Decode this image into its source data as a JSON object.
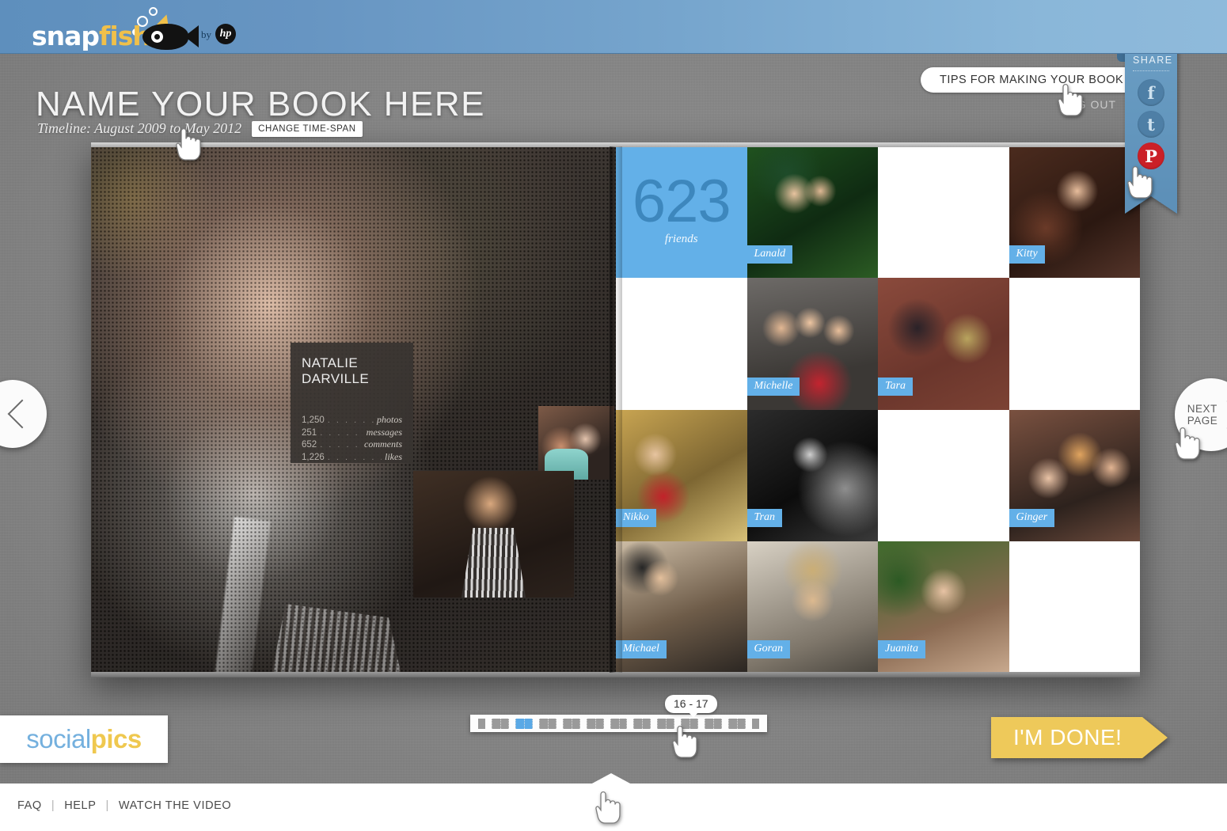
{
  "header": {
    "brand_snap": "snap",
    "brand_fish": "fish",
    "by_label": "by",
    "hp_label": "hp",
    "accent_blue": "#63b0e8",
    "header_blue": "#6795c2"
  },
  "topbar": {
    "tips_label": "TIPS FOR MAKING YOUR BOOK",
    "tips_help_glyph": "?",
    "logout_label": "LOG OUT"
  },
  "share": {
    "label": "SHARE",
    "items": [
      {
        "name": "facebook",
        "glyph": "f",
        "color": "#4e7fa6"
      },
      {
        "name": "twitter",
        "glyph": "t",
        "color": "#4e7fa6"
      },
      {
        "name": "pinterest",
        "glyph": "P",
        "color": "#cb2027"
      }
    ]
  },
  "title": {
    "book_name": "NAME YOUR BOOK HERE",
    "timeline": "Timeline: August 2009 to May 2012",
    "change_span_label": "CHANGE TIME-SPAN"
  },
  "left_page": {
    "person_name_line1": "NATALIE",
    "person_name_line2": "DARVILLE",
    "stats": [
      {
        "value": "1,250",
        "label": "photos"
      },
      {
        "value": "251",
        "label": "messages"
      },
      {
        "value": "652",
        "label": "comments"
      },
      {
        "value": "1,226",
        "label": "likes"
      }
    ],
    "dots": ". . . . . . . . . ."
  },
  "right_page": {
    "friends_count": "623",
    "friends_word": "friends",
    "grid": [
      {
        "type": "count"
      },
      {
        "type": "photo",
        "name": "Lanald",
        "style": "ph-lanald"
      },
      {
        "type": "empty"
      },
      {
        "type": "photo",
        "name": "Kitty",
        "style": "ph-kitty"
      },
      {
        "type": "empty"
      },
      {
        "type": "photo",
        "name": "Michelle",
        "style": "ph-michelle"
      },
      {
        "type": "photo",
        "name": "Tara",
        "style": "ph-tara"
      },
      {
        "type": "empty"
      },
      {
        "type": "photo",
        "name": "Nikko",
        "style": "ph-nikko"
      },
      {
        "type": "photo",
        "name": "Tran",
        "style": "ph-tran"
      },
      {
        "type": "empty"
      },
      {
        "type": "photo",
        "name": "Ginger",
        "style": "ph-ginger"
      },
      {
        "type": "photo",
        "name": "Michael",
        "style": "ph-michael"
      },
      {
        "type": "photo",
        "name": "Goran",
        "style": "ph-goran"
      },
      {
        "type": "photo",
        "name": "Juanita",
        "style": "ph-juanita"
      },
      {
        "type": "empty"
      }
    ]
  },
  "navigation": {
    "prev_icon": "chevron-left-icon",
    "next_label_line1": "NEXT",
    "next_label_line2": "PAGE"
  },
  "page_nav": {
    "current_spread_label": "16 - 17",
    "spreads": [
      {
        "kind": "single",
        "active": false
      },
      {
        "kind": "double",
        "active": false
      },
      {
        "kind": "double",
        "active": true
      },
      {
        "kind": "double",
        "active": false
      },
      {
        "kind": "double",
        "active": false
      },
      {
        "kind": "double",
        "active": false
      },
      {
        "kind": "double",
        "active": false
      },
      {
        "kind": "double",
        "active": false
      },
      {
        "kind": "double",
        "active": false
      },
      {
        "kind": "double",
        "active": false
      },
      {
        "kind": "double",
        "active": false
      },
      {
        "kind": "double",
        "active": false
      },
      {
        "kind": "single",
        "active": false
      }
    ]
  },
  "done": {
    "label": "I'M DONE!",
    "color": "#eec95a"
  },
  "brand_footer": {
    "social": "social",
    "pics": "pics"
  },
  "footer": {
    "links": [
      "FAQ",
      "HELP",
      "WATCH THE VIDEO"
    ],
    "separator": "|"
  }
}
